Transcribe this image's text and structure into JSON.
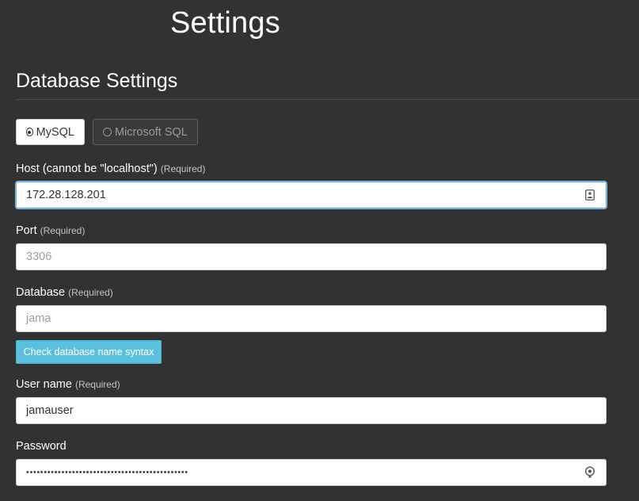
{
  "page": {
    "title": "Settings"
  },
  "section": {
    "title": "Database Settings"
  },
  "db_type": {
    "options": [
      {
        "label": "MySQL",
        "selected": true
      },
      {
        "label": "Microsoft SQL",
        "selected": false
      }
    ]
  },
  "fields": {
    "host": {
      "label": "Host (cannot be \"localhost\")",
      "required": "(Required)",
      "value": "172.28.128.201",
      "icon": "contact-card-icon"
    },
    "port": {
      "label": "Port",
      "required": "(Required)",
      "placeholder": "3306"
    },
    "database": {
      "label": "Database",
      "required": "(Required)",
      "placeholder": "jama"
    },
    "username": {
      "label": "User name",
      "required": "(Required)",
      "value": "jamauser"
    },
    "password": {
      "label": "Password",
      "value": "••••••••••••••••••••••••••••••••••••••••••••••",
      "icon": "password-key-icon"
    }
  },
  "buttons": {
    "check_db_syntax": "Check database name syntax"
  },
  "colors": {
    "background": "#323232",
    "accent": "#5bc0de",
    "focus": "#5aaad8"
  }
}
